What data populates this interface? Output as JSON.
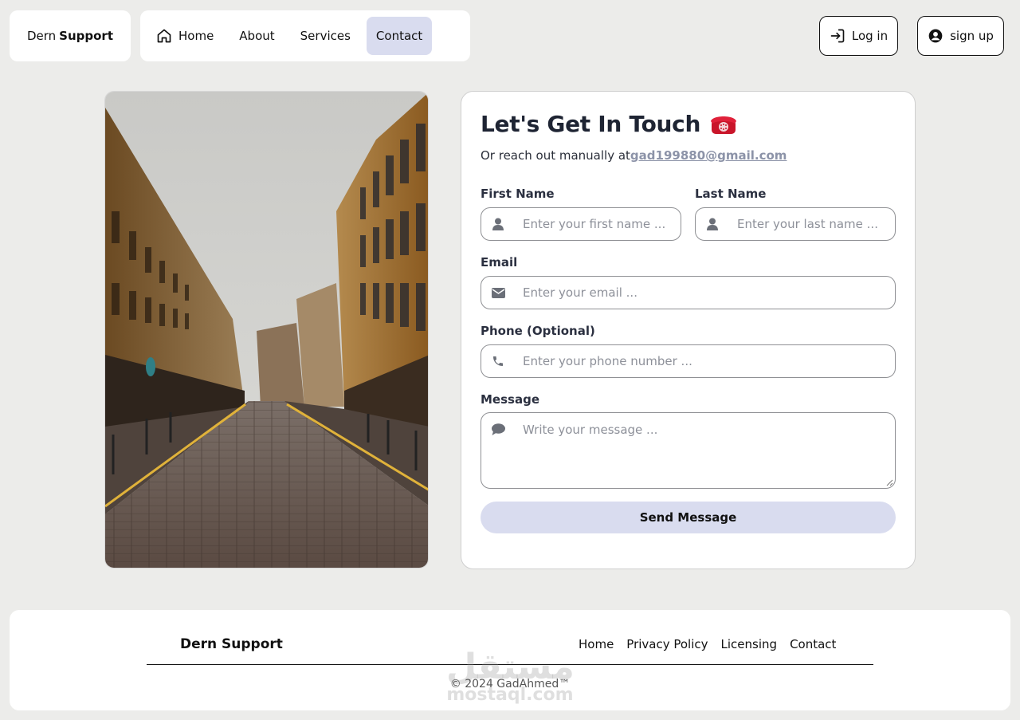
{
  "header": {
    "logo_prefix": "Dern",
    "logo_bold": "Support",
    "nav": [
      {
        "label": "Home"
      },
      {
        "label": "About"
      },
      {
        "label": "Services"
      },
      {
        "label": "Contact"
      }
    ],
    "active_nav": "Contact",
    "login_label": "Log in",
    "signup_label": "sign up"
  },
  "contact": {
    "title": "Let's Get In Touch",
    "reach_text": "Or reach out manually at",
    "email_link": "gad199880@gmail.com",
    "first_name_label": "First Name",
    "first_name_placeholder": "Enter your first name ...",
    "last_name_label": "Last Name",
    "last_name_placeholder": "Enter your last name ...",
    "email_label": "Email",
    "email_placeholder": "Enter your email ...",
    "phone_label": "Phone (Optional)",
    "phone_placeholder": "Enter your phone number ...",
    "message_label": "Message",
    "message_placeholder": "Write your message ...",
    "submit_label": "Send Message"
  },
  "footer": {
    "brand": "Dern Support",
    "links": [
      "Home",
      "Privacy Policy",
      "Licensing",
      "Contact"
    ],
    "copyright": "© 2024 GadAhmed™",
    "watermark_ar": "مستقل",
    "watermark_latin": "mostaql.com"
  },
  "colors": {
    "page_bg": "#ececea",
    "accent": "#d9dcef",
    "link_muted": "#8c93a8"
  }
}
